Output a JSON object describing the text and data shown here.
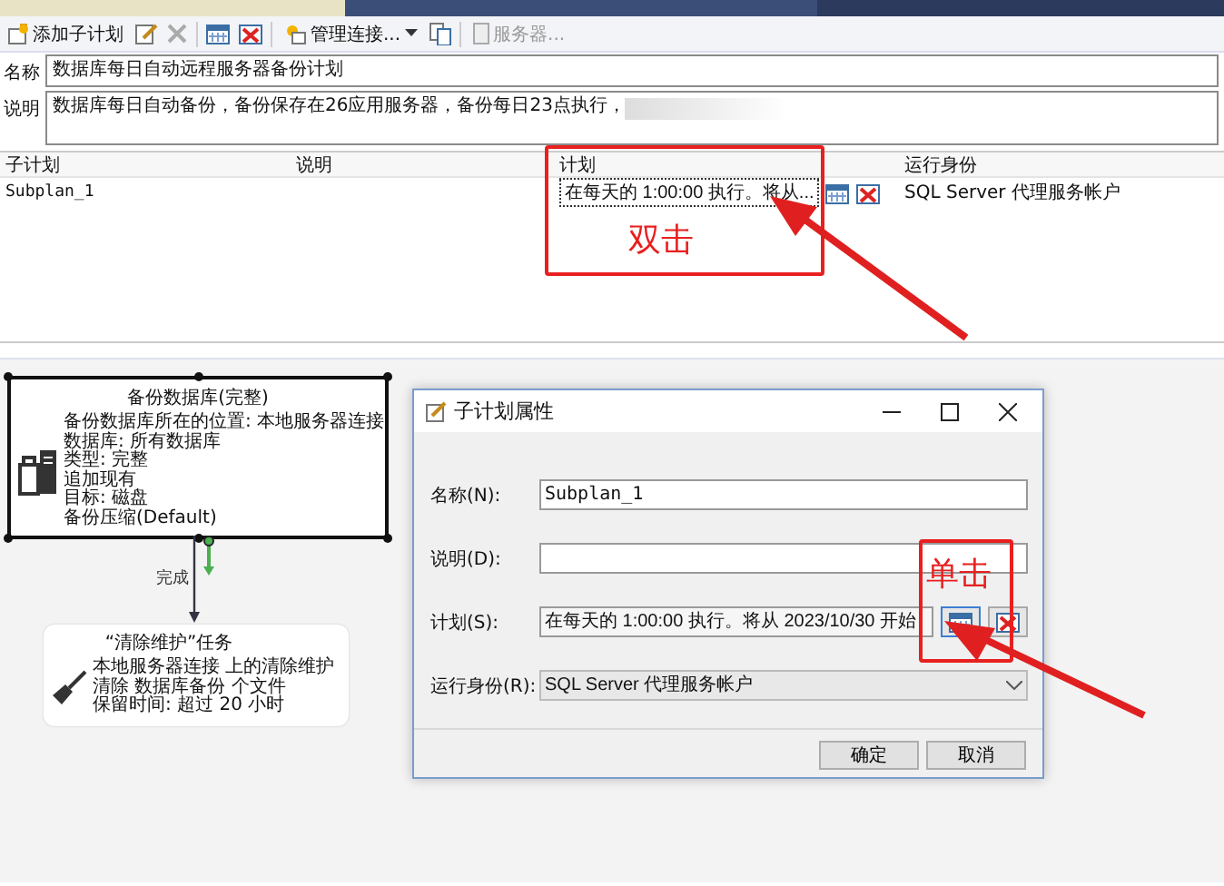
{
  "toolbar": {
    "add_subplan": "添加子计划",
    "manage_connections": "管理连接...",
    "servers": {
      "label": "服务器...",
      "disabled": true
    }
  },
  "plan": {
    "name_label": "名称",
    "name": "数据库每日自动远程服务器备份计划",
    "description_label": "说明",
    "description": "数据库每日自动备份，备份保存在26应用服务器，备份每日23点执行，"
  },
  "subplans": {
    "columns": [
      "子计划",
      "说明",
      "计划",
      "运行身份"
    ],
    "rows": [
      {
        "name": "Subplan_1",
        "schedule": "在每天的 1:00:00 执行。将从...",
        "run_as": "SQL Server 代理服务帐户"
      }
    ]
  },
  "canvas": {
    "tasks": [
      {
        "kind": "backup",
        "title": "备份数据库(完整)",
        "lines": [
          "备份数据库所在的位置: 本地服务器连接",
          "数据库: 所有数据库",
          "类型: 完整",
          "追加现有",
          "目标: 磁盘",
          "备份压缩(Default)"
        ]
      },
      {
        "kind": "cleanup",
        "title": "“清除维护”任务",
        "lines": [
          "本地服务器连接 上的清除维护",
          "清除 数据库备份 个文件",
          "保留时间: 超过 20 小时"
        ]
      }
    ],
    "connector": {
      "label": "完成"
    }
  },
  "dialog": {
    "title": "子计划属性",
    "fields": [
      {
        "kind": "text",
        "label": "名称(N):",
        "value": "Subplan_1"
      },
      {
        "kind": "text",
        "label": "说明(D):"
      },
      {
        "kind": "schedule",
        "label": "计划(S):",
        "value": "在每天的 1:00:00 执行。将从 2023/10/30 开始"
      },
      {
        "kind": "dropdown",
        "label": "运行身份(R):",
        "value": "SQL Server 代理服务帐户"
      }
    ],
    "buttons": [
      "确定",
      "取消"
    ]
  },
  "annotations": [
    {
      "text": "双击"
    },
    {
      "text": "单击"
    }
  ]
}
